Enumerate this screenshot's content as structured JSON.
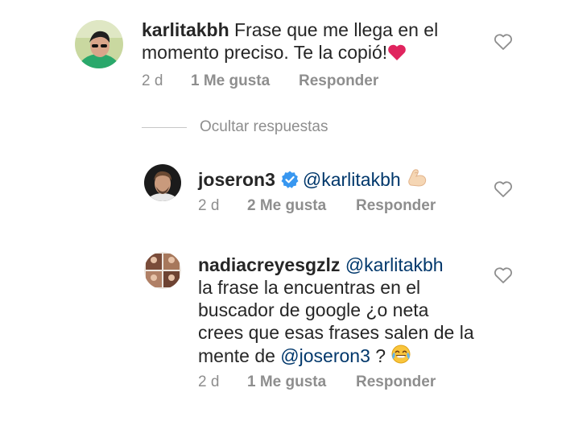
{
  "comments": [
    {
      "username": "karlitakbh",
      "text_line1": "Frase que me llega en el",
      "text_line2": "momento preciso. Te la copió!",
      "emoji": "heart-emoji",
      "time": "2 d",
      "likes": "1 Me gusta",
      "reply_label": "Responder"
    }
  ],
  "hide_replies_label": "Ocultar respuestas",
  "replies": [
    {
      "username": "joseron3",
      "verified": true,
      "mention": "@karlitakbh",
      "emoji": "flexed-biceps-emoji",
      "time": "2 d",
      "likes": "2 Me gusta",
      "reply_label": "Responder"
    },
    {
      "username": "nadiacreyesgzlz",
      "mention": "@karlitakbh",
      "line2": "la frase la encuentras en el",
      "line3": "buscador de google ¿o neta",
      "line4": "crees que esas frases salen de la",
      "line5_prefix": "mente de ",
      "line5_mention": "@joseron3",
      "line5_suffix": " ?",
      "emoji": "tears-of-joy-emoji",
      "time": "2 d",
      "likes": "1 Me gusta",
      "reply_label": "Responder"
    }
  ],
  "colors": {
    "text": "#262626",
    "meta": "#8e8e8e",
    "mention": "#00376b",
    "verified": "#3897f0",
    "heart_emoji": "#ed4956"
  },
  "icons": [
    "heart-outline-icon",
    "verified-badge-icon"
  ]
}
